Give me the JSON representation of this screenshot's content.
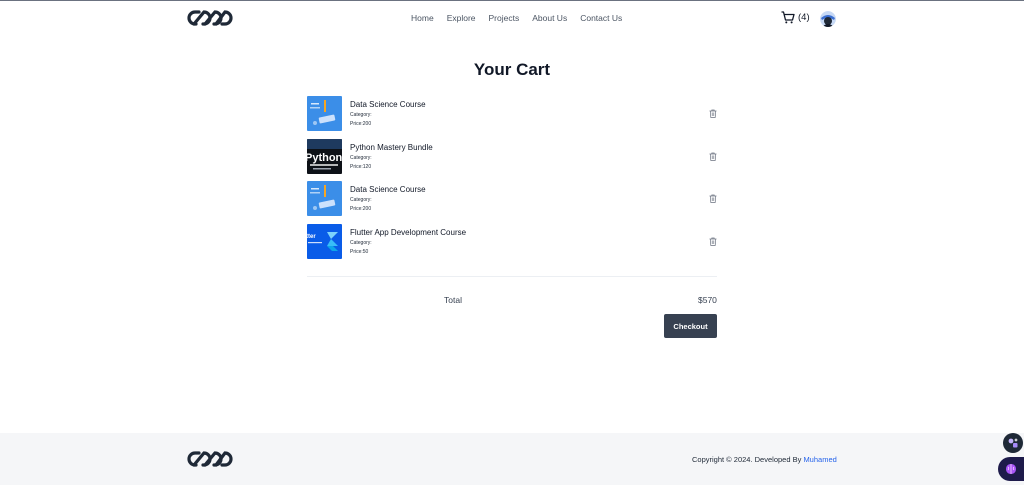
{
  "nav": {
    "links": [
      "Home",
      "Explore",
      "Projects",
      "About Us",
      "Contact Us"
    ],
    "cart_count": "(4)"
  },
  "page": {
    "title": "Your Cart"
  },
  "cart": {
    "items": [
      {
        "name": "Data Science Course",
        "category": "Category:",
        "price": "Price:200",
        "thumb": "data-science"
      },
      {
        "name": "Python Mastery Bundle",
        "category": "Category:",
        "price": "Price:120",
        "thumb": "python"
      },
      {
        "name": "Data Science Course",
        "category": "Category:",
        "price": "Price:200",
        "thumb": "data-science"
      },
      {
        "name": "Flutter App Development Course",
        "category": "Category:",
        "price": "Price:50",
        "thumb": "flutter"
      }
    ],
    "total_label": "Total",
    "total_value": "$570",
    "checkout_label": "Checkout"
  },
  "footer": {
    "copyright": "Copyright © 2024. Developed By ",
    "author": "Muhamed"
  },
  "colors": {
    "accent_dark": "#374151",
    "link": "#2563eb",
    "footer_bg": "#f5f6f8"
  },
  "icons": [
    "logo-icon",
    "cart-icon",
    "avatar",
    "trash-icon",
    "assistant-icon",
    "brain-icon"
  ]
}
